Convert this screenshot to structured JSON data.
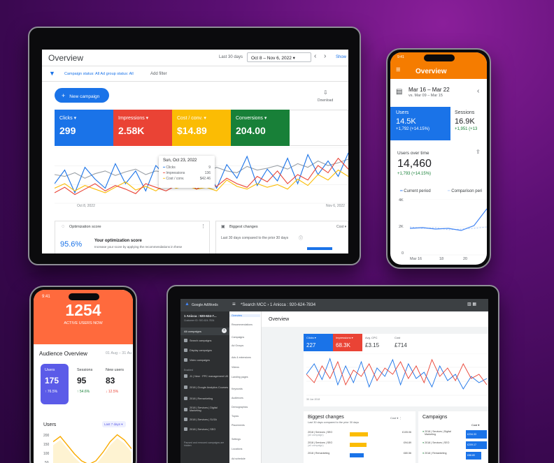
{
  "tablet1": {
    "title": "Overview",
    "date_prefix": "Last 30 days",
    "date_range": "Oct 8 – Nov 6, 2022",
    "show": "Show",
    "filter_text": "Campaign status: All  Ad group status: All",
    "add_filter": "Add filter",
    "new_campaign": "New campaign",
    "download": "Download",
    "kpis": [
      {
        "label": "Clicks",
        "value": "299",
        "color": "#1a73e8"
      },
      {
        "label": "Impressions",
        "value": "2.58K",
        "color": "#ea4335"
      },
      {
        "label": "Cost / conv.",
        "value": "$14.89",
        "color": "#fbbc04"
      },
      {
        "label": "Conversions",
        "value": "204.00",
        "color": "#188038"
      }
    ],
    "tooltip": {
      "date": "Sun, Oct 23, 2022",
      "rows": [
        {
          "label": "Clicks",
          "value": "9"
        },
        {
          "label": "Impressions",
          "value": "136"
        },
        {
          "label": "Cost / conv.",
          "value": "$42.46"
        }
      ]
    },
    "x_start": "Oct 8, 2022",
    "x_end": "Nov 6, 2022",
    "opt_title": "Optimization score",
    "opt_value": "95.6%",
    "opt_heading": "Your optimization score",
    "opt_desc": "Increase your score by applying the recommendations in these",
    "bc_title": "Biggest changes",
    "bc_cost": "Cost",
    "bc_sub": "Last 30 days compared to the prior 30 days"
  },
  "phone1": {
    "time": "9:41",
    "title": "Overview",
    "date_range": "Mar 16 – Mar 22",
    "compare": "vs. Mar 09 – Mar 15",
    "tab1_label": "Users",
    "tab1_value": "14.5K",
    "tab1_delta": "+1,792 (+14.15%)",
    "tab2_label": "Sessions",
    "tab2_value": "16.9K",
    "tab2_delta": "+1,951 (+13",
    "chart_title": "Users over time",
    "big_value": "14,460",
    "big_delta": "+1,793 (+14.15%)",
    "legend_current": "Current period",
    "legend_compare": "Comparison peri",
    "y_ticks": [
      "4K",
      "2K",
      "0"
    ],
    "x_ticks": [
      "Mar 16",
      "18",
      "20"
    ]
  },
  "phone2": {
    "time": "9:41",
    "active": "1254",
    "active_label": "ACTIVE USERS NOW",
    "section": "Audience Overview",
    "date": "01 Aug – 31 Au",
    "cards": [
      {
        "label": "Users",
        "value": "175",
        "delta": "↑ 76.5%"
      },
      {
        "label": "Sessions",
        "value": "95",
        "delta": "↑ 54.6%"
      },
      {
        "label": "New users",
        "value": "83",
        "delta": "↓ 12.5%"
      }
    ],
    "users_title": "Users",
    "users_filter": "Last 7 days",
    "y_ticks": [
      "200",
      "150",
      "100",
      "50"
    ]
  },
  "tablet2": {
    "logo": "Google AdWords",
    "breadcrumb": "*Search MCC  ›  1 Anicca : 920-624-7834",
    "account": "1 Anicca : 920-624-7...",
    "customer": "Customer ID: 920-624-7834",
    "all_campaigns": "All campaigns",
    "enabled": "Enabled",
    "sidebar": [
      "Search campaigns",
      "Display campaigns",
      "Video campaigns"
    ],
    "campaigns": [
      "J1 | New · PPC management UK",
      "2018 | Google Analytics Courses",
      "2018 | Remarketing",
      "2018 | Services | Digital Marketing",
      "2018 | Services | SLSA",
      "2018 | Services | SEO"
    ],
    "paused_note": "Paused and removed campaigns are hidden",
    "nav": [
      "Overview",
      "Recommendations",
      "Campaigns",
      "Ad Groups",
      "Ads & extensions",
      "Videos",
      "Landing pages",
      "Keywords",
      "Audiences",
      "Demographics",
      "Topics",
      "Placements",
      "Settings",
      "Locations",
      "Ad schedule"
    ],
    "overview": "Overview",
    "kpis": [
      {
        "label": "Clicks",
        "value": "227",
        "color": "#1a73e8"
      },
      {
        "label": "Impressions",
        "value": "68.3K",
        "color": "#ea4335"
      },
      {
        "label": "Avg. CPC",
        "value": "£3.15",
        "color": "#fff"
      },
      {
        "label": "Cost",
        "value": "£714",
        "color": "#fff"
      }
    ],
    "x_label": "30 Jun 2018",
    "bc_title": "Biggest changes",
    "bc_sub": "Last 30 days compared to the prior 30 days",
    "bc_cost": "Cost",
    "bc_rows": [
      {
        "name": "2018 | Services | SEO",
        "sub": "(all campaign)",
        "value": "£105.06"
      },
      {
        "name": "2018 | Services | SEO",
        "sub": "(all campaign)",
        "value": "£94.89"
      },
      {
        "name": "2018 | Remarketing",
        "sub": "",
        "value": "£80.56"
      }
    ],
    "camp_title": "Campaigns",
    "camp_cost": "Cost",
    "camp_rows": [
      {
        "name": "2018 | Services | Digital Marketing",
        "value": "£234.33"
      },
      {
        "name": "2018 | Services | SEO",
        "value": "£209.17"
      },
      {
        "name": "2018 | Remarketing",
        "value": "£88.80"
      }
    ]
  },
  "chart_data": [
    {
      "type": "line",
      "series": [
        {
          "values": [
            40,
            38,
            42,
            36,
            41,
            44,
            39,
            43,
            46,
            40,
            44,
            42,
            47,
            41,
            45,
            43,
            48,
            44,
            42,
            49,
            45,
            47,
            50,
            46,
            52,
            48,
            55,
            50,
            53,
            57
          ]
        },
        {
          "values": [
            30,
            45,
            20,
            48,
            35,
            25,
            52,
            30,
            44,
            22,
            50,
            38,
            28,
            55,
            33,
            47,
            25,
            51,
            36,
            60,
            28,
            46,
            33,
            58,
            30,
            62,
            40,
            55,
            38,
            64
          ]
        },
        {
          "values": [
            25,
            30,
            22,
            28,
            24,
            20,
            26,
            32,
            23,
            27,
            22,
            30,
            25,
            28,
            24,
            26,
            22,
            34,
            27,
            24,
            30,
            26,
            29,
            24,
            35,
            28,
            40,
            34,
            45,
            38
          ]
        },
        {
          "values": [
            20,
            26,
            18,
            24,
            30,
            22,
            28,
            24,
            19,
            30,
            26,
            22,
            28,
            34,
            24,
            30,
            27,
            36,
            30,
            26,
            38,
            32,
            44,
            30,
            40,
            34,
            50,
            42,
            58,
            46
          ]
        }
      ]
    },
    {
      "type": "line",
      "series": [
        {
          "name": "Current period",
          "values": [
            1900,
            1950,
            1850,
            1900,
            1750,
            2100,
            3300
          ]
        },
        {
          "name": "Comparison peri",
          "values": [
            2000,
            1900,
            1950,
            1800,
            1850,
            1900,
            2000
          ]
        }
      ]
    },
    {
      "type": "area",
      "series": [
        {
          "values": [
            150,
            180,
            130,
            80,
            40,
            20,
            40,
            90,
            150,
            190,
            160,
            110
          ]
        }
      ]
    },
    {
      "type": "line",
      "series": [
        {
          "values": [
            60,
            70,
            55,
            75,
            50,
            68,
            52,
            72,
            48,
            66,
            58,
            74,
            50,
            70,
            56,
            62,
            48,
            68,
            54,
            60,
            46,
            58,
            52,
            56
          ]
        },
        {
          "values": [
            50,
            42,
            58,
            46,
            62,
            40,
            54,
            48,
            60,
            44,
            56,
            50,
            62,
            46,
            58,
            42,
            64,
            48,
            56,
            44,
            60,
            46,
            50,
            40
          ]
        }
      ]
    }
  ]
}
